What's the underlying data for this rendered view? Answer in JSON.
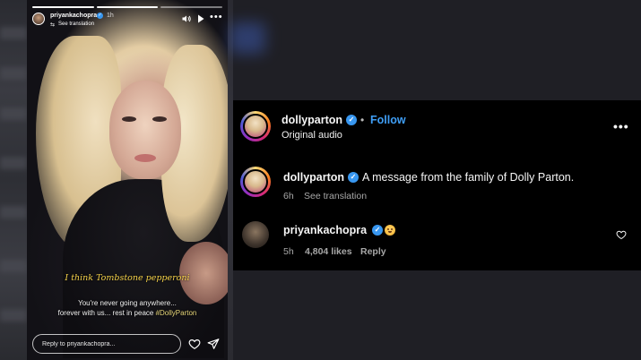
{
  "story": {
    "username": "priyankachopra",
    "time": "1h",
    "see_translation": "See translation",
    "caption_quote": "I think Tombstone pepperoni",
    "caption_line1": "You're never going anywhere...",
    "caption_line2_prefix": "forever with us... rest in peace ",
    "caption_hashtag": "#DollyParton",
    "reply_placeholder": "Reply to priyankachopra...",
    "more": "•••"
  },
  "post": {
    "author": {
      "username": "dollyparton",
      "follow_label": "Follow",
      "dot": "•",
      "audio": "Original audio"
    },
    "more": "•••",
    "caption": {
      "username": "dollyparton",
      "text": "A message from the family of Dolly Parton.",
      "time": "6h",
      "see_translation": "See translation"
    },
    "comment": {
      "username": "priyankachopra",
      "emoji": "flushed-face-emoji",
      "time": "5h",
      "likes": "4,804 likes",
      "reply_label": "Reply"
    }
  },
  "colors": {
    "panel_bg": "#000000",
    "page_bg": "#1f1f25",
    "follow_blue": "#3f9ef5",
    "verified_blue": "#3897f0",
    "caption_yellow": "#f5d24a",
    "muted_text": "#a8a8a8"
  }
}
